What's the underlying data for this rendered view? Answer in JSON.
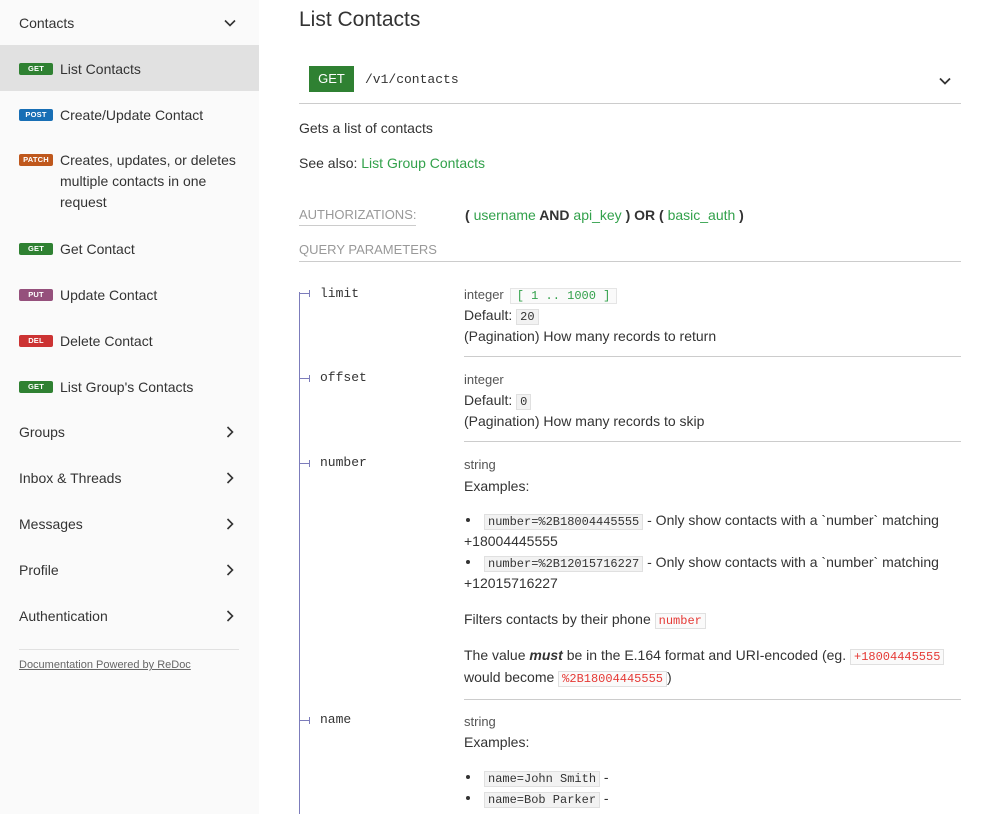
{
  "sidebar": {
    "group_contacts": "Contacts",
    "items": [
      {
        "method": "GET",
        "label": "List Contacts"
      },
      {
        "method": "POST",
        "label": "Create/Update Contact"
      },
      {
        "method": "PATCH",
        "label_l1": "Creates, updates, or deletes",
        "label_l2": "multiple contacts in one",
        "label_l3": "request"
      },
      {
        "method": "GET",
        "label": "Get Contact"
      },
      {
        "method": "PUT",
        "label": "Update Contact"
      },
      {
        "method": "DEL",
        "label": "Delete Contact"
      },
      {
        "method": "GET",
        "label": "List Group's Contacts"
      }
    ],
    "groups": [
      "Groups",
      "Inbox & Threads",
      "Messages",
      "Profile",
      "Authentication"
    ],
    "footer": "Documentation Powered by ReDoc"
  },
  "main": {
    "title": "List Contacts",
    "method": "GET",
    "path": "/v1/contacts",
    "description": "Gets a list of contacts",
    "see_also_prefix": "See also: ",
    "see_also_link": "List Group Contacts",
    "authorizations_label": "AUTHORIZATIONS:",
    "auth": {
      "open1": "( ",
      "username": "username",
      "and": " AND ",
      "api_key": "api_key",
      "close_or": " ) OR ( ",
      "basic_auth": "basic_auth",
      "close": " )"
    },
    "query_params_label": "QUERY PARAMETERS",
    "params": {
      "limit": {
        "name": "limit",
        "type": "integer",
        "range": "[ 1 .. 1000 ]",
        "default_label": "Default:",
        "default": "20",
        "desc": "(Pagination) How many records to return"
      },
      "offset": {
        "name": "offset",
        "type": "integer",
        "default_label": "Default:",
        "default": "0",
        "desc": "(Pagination) How many records to skip"
      },
      "number": {
        "name": "number",
        "type": "string",
        "examples_label": "Examples:",
        "ex1_code": "number=%2B18004445555",
        "ex1_text": " - Only show contacts with a `number` matching",
        "ex1_text2": "+18004445555",
        "ex2_code": "number=%2B12015716227",
        "ex2_text": " - Only show contacts with a `number` matching",
        "ex2_text2": "+12015716227",
        "filter_text": "Filters contacts by their phone ",
        "filter_code": "number",
        "value_pre": "The value ",
        "value_must": "must",
        "value_mid": " be in the E.164 format and URI-encoded (eg. ",
        "value_code1": "+18004445555",
        "value_line2_pre": "would become ",
        "value_code2": "%2B18004445555",
        "value_end": ")"
      },
      "name": {
        "name": "name",
        "type": "string",
        "examples_label": "Examples:",
        "ex1_code": "name=John Smith",
        "ex1_text": " -",
        "ex2_code": "name=Bob Parker",
        "ex2_text": " -"
      }
    }
  },
  "colors": {
    "get": "#2f8132",
    "post": "#186fb5",
    "patch": "#bf581d",
    "put": "#95507c",
    "delete": "#cc3333",
    "link": "#32a14b",
    "sidebar_bg": "#fafafa",
    "active_bg": "#e1e1e1"
  }
}
